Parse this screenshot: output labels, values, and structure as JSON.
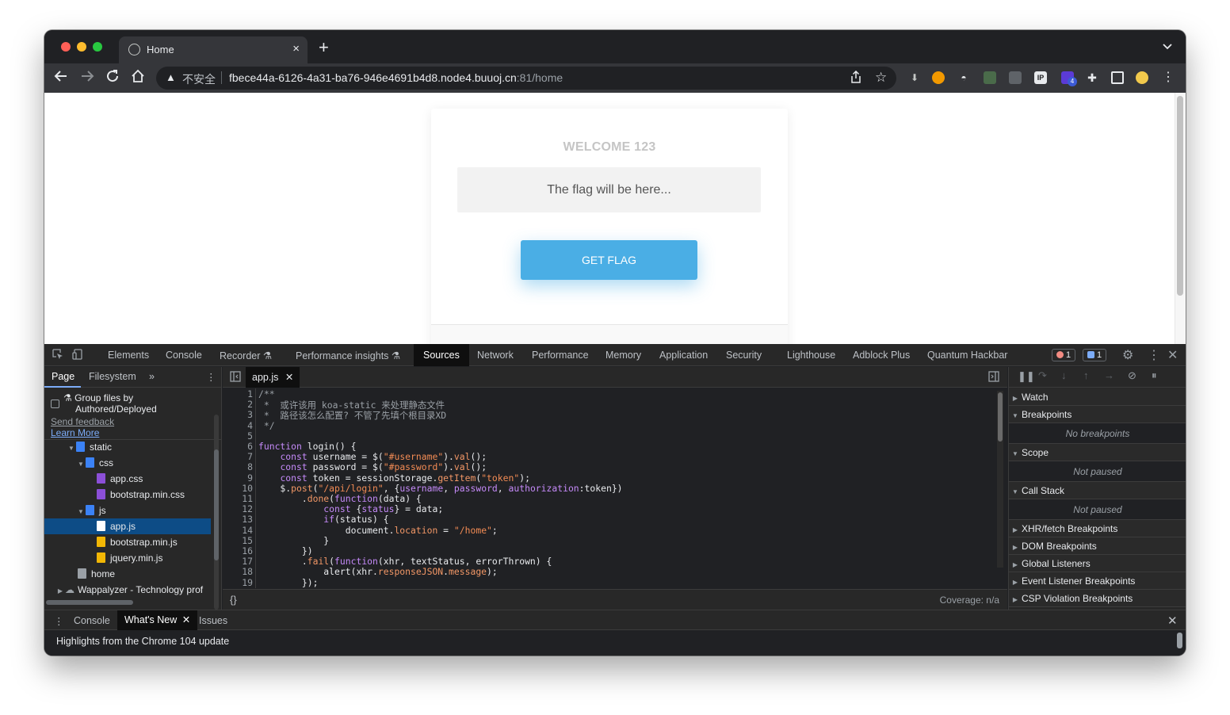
{
  "browser": {
    "tab_title": "Home",
    "tab_close": "×",
    "new_tab": "+",
    "tab_menu": "⌄",
    "security_label": "不安全",
    "url_host": "fbece44a-6126-4a31-ba76-946e4691b4d8.node4.buuoj.cn",
    "url_rest": ":81/home",
    "ext_badge": "4",
    "colors": {
      "close": "#ff5f57",
      "minimize": "#febc2e",
      "maximize": "#28c840"
    }
  },
  "page": {
    "welcome": "WELCOME 123",
    "flag_placeholder": "The flag will be here...",
    "get_flag_label": "GET FLAG",
    "button_color": "#4aaee5"
  },
  "devtools": {
    "tabs": [
      "Elements",
      "Console",
      "Recorder",
      "Performance insights",
      "Sources",
      "Network",
      "Performance",
      "Memory",
      "Application",
      "Security",
      "Lighthouse",
      "Adblock Plus",
      "Quantum Hackbar"
    ],
    "active_tab": "Sources",
    "error_count": "1",
    "message_count": "1",
    "navigator": {
      "tab_page": "Page",
      "tab_filesystem": "Filesystem",
      "more": "»",
      "group_line1": "Group files by",
      "group_line2": "Authored/Deployed",
      "send_feedback": "Send feedback",
      "learn_more": "Learn More",
      "tree": [
        "static",
        "css",
        "app.css",
        "bootstrap.min.css",
        "js",
        "app.js",
        "bootstrap.min.js",
        "jquery.min.js",
        "home",
        "Wappalyzer - Technology prof"
      ]
    },
    "editor": {
      "file_tab": "app.js",
      "format_label": "{}",
      "coverage": "Coverage: n/a",
      "line_numbers": [
        "1",
        "2",
        "3",
        "4",
        "5",
        "6",
        "7",
        "8",
        "9",
        "10",
        "11",
        "12",
        "13",
        "14",
        "15",
        "16",
        "17",
        "18",
        "19"
      ]
    },
    "debugger": {
      "watch": "Watch",
      "breakpoints": "Breakpoints",
      "no_breakpoints": "No breakpoints",
      "scope": "Scope",
      "not_paused_scope": "Not paused",
      "call_stack": "Call Stack",
      "not_paused_stack": "Not paused",
      "xhr": "XHR/fetch Breakpoints",
      "dom": "DOM Breakpoints",
      "global": "Global Listeners",
      "event": "Event Listener Breakpoints",
      "csp": "CSP Violation Breakpoints"
    },
    "drawer": {
      "console": "Console",
      "whats_new": "What's New",
      "issues": "Issues",
      "highlights": "Highlights from the Chrome 104 update"
    }
  }
}
